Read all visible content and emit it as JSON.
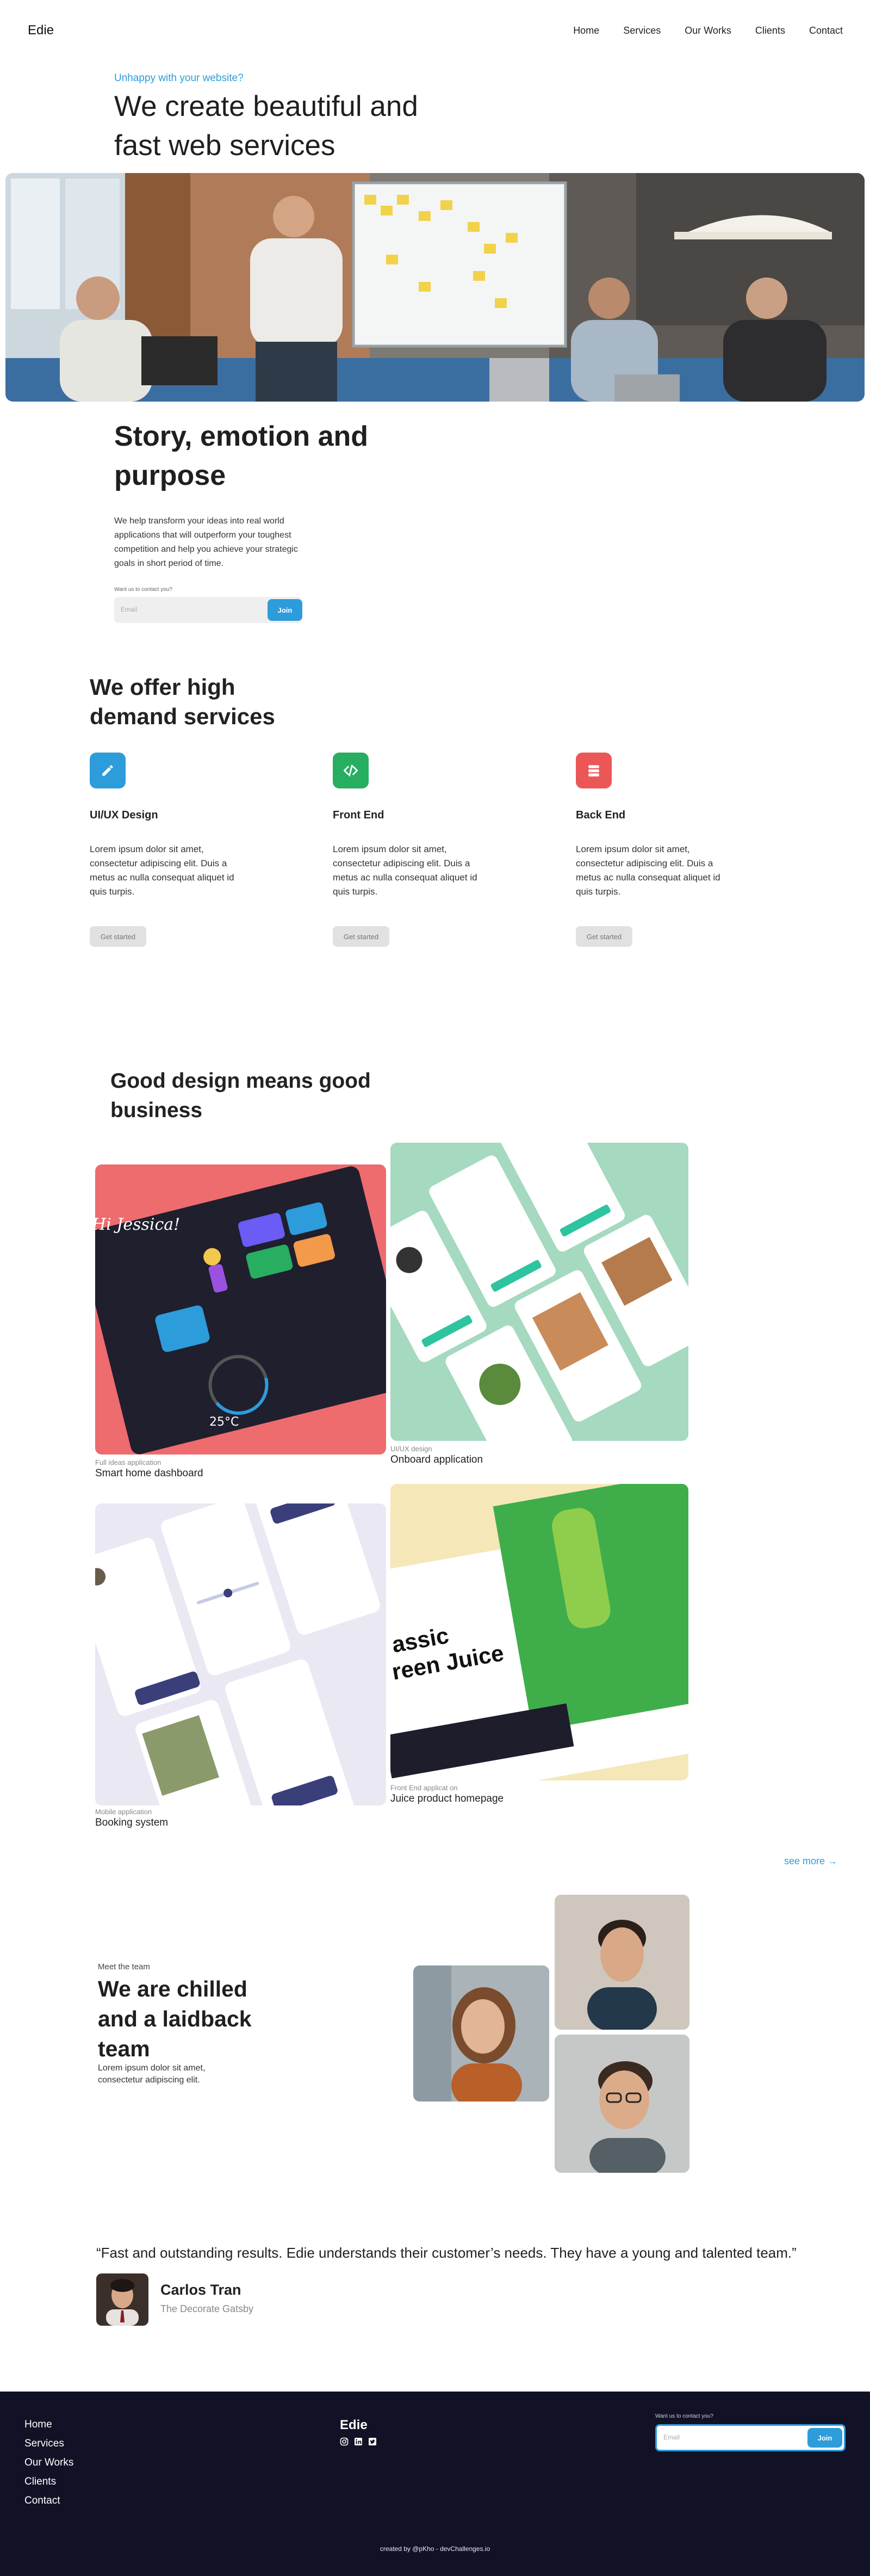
{
  "header": {
    "logo": "Edie",
    "nav": [
      "Home",
      "Services",
      "Our Works",
      "Clients",
      "Contact"
    ]
  },
  "hero": {
    "eyebrow": "Unhappy with your website?",
    "title": "We create beautiful and fast web services"
  },
  "story": {
    "title": "Story, emotion and purpose",
    "body": "We help transform your ideas into real world applications that will outperform your toughest competition and help you achieve your strategic goals in short period of time.",
    "form_label": "Want us to contact you?",
    "email_placeholder": "Email",
    "join_label": "Join"
  },
  "services": {
    "title": "We offer high demand services",
    "items": [
      {
        "name": "UI/UX Design",
        "icon": "pencil-icon",
        "color": "#2d9cdb",
        "desc": "Lorem ipsum dolor sit amet, consectetur adipiscing elit. Duis a metus ac nulla consequat aliquet id quis turpis.",
        "cta": "Get started"
      },
      {
        "name": "Front End",
        "icon": "code-icon",
        "color": "#27ae60",
        "desc": "Lorem ipsum dolor sit amet, consectetur adipiscing elit. Duis a metus ac nulla consequat aliquet id quis turpis.",
        "cta": "Get started"
      },
      {
        "name": "Back End",
        "icon": "server-icon",
        "color": "#eb5757",
        "desc": "Lorem ipsum dolor sit amet, consectetur adipiscing elit. Duis a metus ac nulla consequat aliquet id quis turpis.",
        "cta": "Get started"
      }
    ]
  },
  "works": {
    "title": "Good design means good business",
    "items": [
      {
        "category": "Full ideas application",
        "title": "Smart home dashboard"
      },
      {
        "category": "UI/UX design",
        "title": "Onboard application"
      },
      {
        "category": "Mobile application",
        "title": "Booking system"
      },
      {
        "category": "Front End applicat on",
        "title": "Juice product homepage"
      }
    ],
    "mockup_text": {
      "greeting": "Hi Jessica!",
      "temp": "25°C",
      "juice_title_1": "assic",
      "juice_title_2": "reen Juice"
    },
    "see_more": "see more →"
  },
  "team": {
    "eyebrow": "Meet the team",
    "title": "We are chilled and a laidback team",
    "body": "Lorem ipsum dolor sit amet, consectetur adipiscing elit."
  },
  "testimonial": {
    "quote": "“Fast and outstanding results. Edie understands their customer’s needs. They have a young and talented team.”",
    "name": "Carlos Tran",
    "role": "The Decorate Gatsby"
  },
  "footer": {
    "links": [
      "Home",
      "Services",
      "Our Works",
      "Clients",
      "Contact"
    ],
    "logo": "Edie",
    "form_label": "Want us to contact you?",
    "email_placeholder": "Email",
    "join_label": "Join",
    "credit": "created by @pKho - devChallenges.io"
  },
  "colors": {
    "accent": "#2d9cdb",
    "footer_bg": "#121226"
  }
}
